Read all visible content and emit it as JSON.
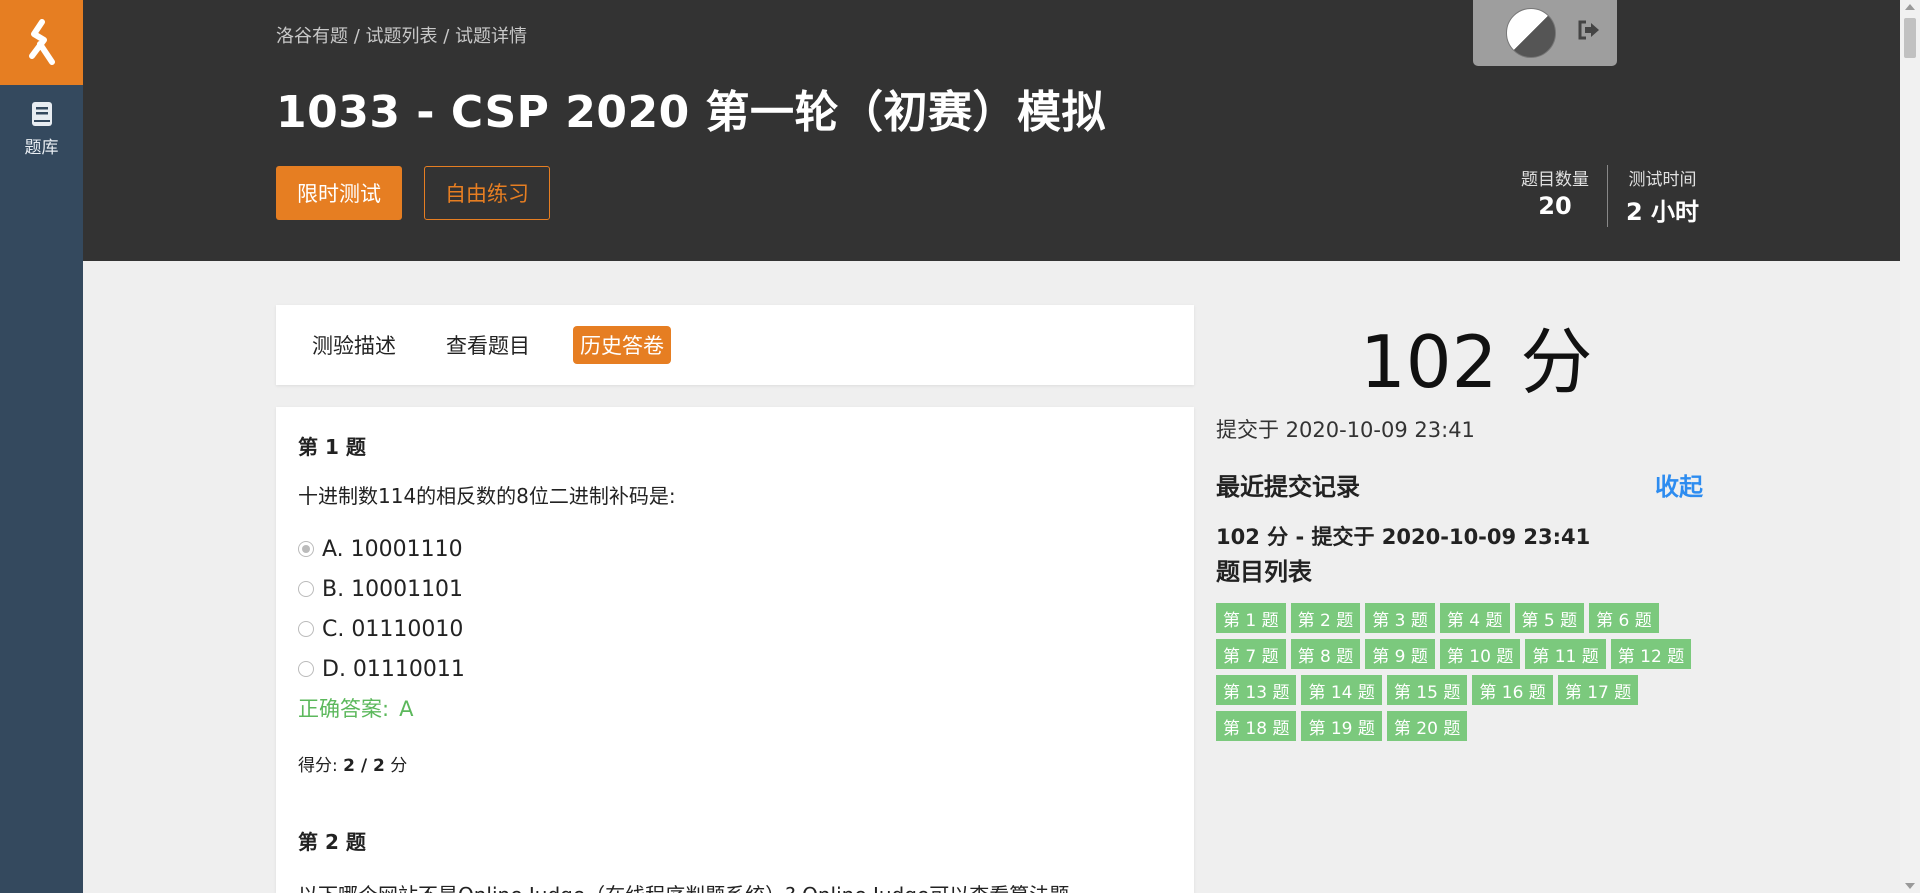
{
  "sidebar": {
    "items": [
      {
        "label": "题库",
        "icon": "book-icon"
      }
    ]
  },
  "header": {
    "breadcrumb": [
      "洛谷有题",
      "试题列表",
      "试题详情"
    ],
    "title": "1033 - CSP 2020 第一轮（初赛）模拟",
    "primary_button": "限时测试",
    "secondary_button": "自由练习",
    "stats": [
      {
        "label": "题目数量",
        "value": "20"
      },
      {
        "label": "测试时间",
        "value": "2 小时"
      }
    ]
  },
  "tabs": [
    {
      "label": "测验描述",
      "active": false
    },
    {
      "label": "查看题目",
      "active": false
    },
    {
      "label": "历史答卷",
      "active": true
    }
  ],
  "question1": {
    "heading": "第 1 题",
    "text": "十进制数114的相反数的8位二进制补码是:",
    "options": [
      {
        "label": "A. 10001110",
        "checked": true
      },
      {
        "label": "B. 10001101",
        "checked": false
      },
      {
        "label": "C. 01110010",
        "checked": false
      },
      {
        "label": "D. 01110011",
        "checked": false
      }
    ],
    "answer_label": "正确答案:",
    "answer_value": "A",
    "score_prefix": "得分:",
    "score_value": "2 / 2",
    "score_suffix": "分"
  },
  "question2": {
    "heading": "第 2 题",
    "text": "以下哪个网站不是Online Judge（在线程序判题系统）? Online Judge可以查看算法题"
  },
  "result": {
    "big_score": "102 分",
    "submitted": "提交于 2020-10-09 23:41",
    "recent_title": "最近提交记录",
    "collapse": "收起",
    "record": "102 分 - 提交于 2020-10-09 23:41",
    "list_title": "题目列表",
    "questions": [
      "第 1 题",
      "第 2 题",
      "第 3 题",
      "第 4 题",
      "第 5 题",
      "第 6 题",
      "第 7 题",
      "第 8 题",
      "第 9 题",
      "第 10 题",
      "第 11 题",
      "第 12 题",
      "第 13 题",
      "第 14 题",
      "第 15 题",
      "第 16 题",
      "第 17 题",
      "第 18 题",
      "第 19 题",
      "第 20 题"
    ]
  },
  "colors": {
    "accent": "#e67e22",
    "sidebar": "#34495e",
    "header": "#333333",
    "correct": "#5cb85c",
    "chip": "#7bc97d",
    "link": "#2d8cf0"
  }
}
